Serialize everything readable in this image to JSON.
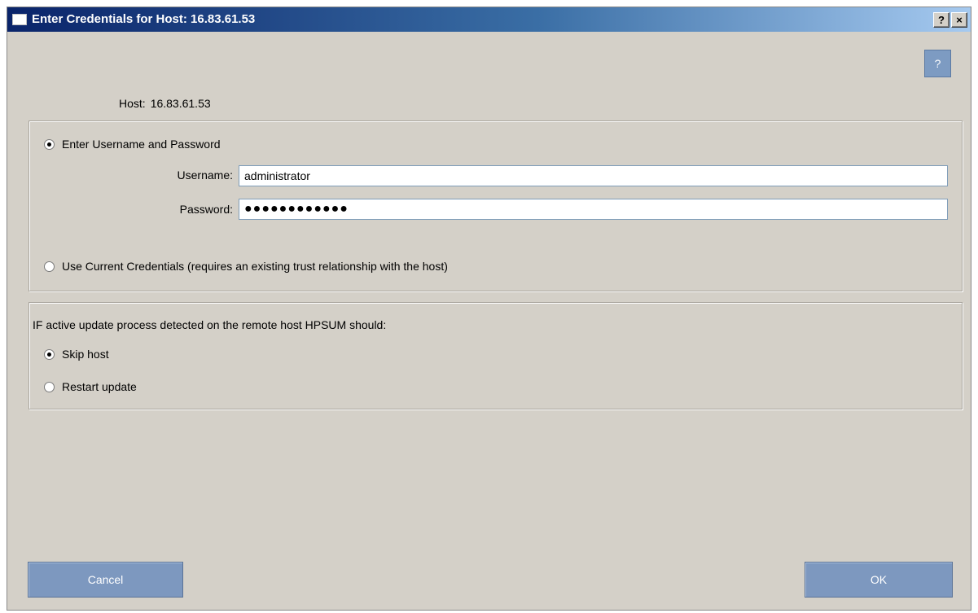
{
  "window": {
    "title": "Enter Credentials for Host: 16.83.61.53",
    "help_glyph": "?",
    "close_glyph": "×"
  },
  "help_button": {
    "label": "?",
    "icon": "help-icon"
  },
  "host": {
    "label": "Host:",
    "value": "16.83.61.53"
  },
  "credentials": {
    "option_manual_label": "Enter Username and Password",
    "option_manual_selected": true,
    "username_label": "Username:",
    "username_value": "administrator",
    "password_label": "Password:",
    "password_value": "●●●●●●●●●●●●",
    "option_current_label": "Use Current Credentials (requires an existing trust relationship with the host)",
    "option_current_selected": false
  },
  "update_policy": {
    "prompt": "IF active update process detected on the remote host HPSUM should:",
    "option_skip_label": "Skip host",
    "option_skip_selected": true,
    "option_restart_label": "Restart update",
    "option_restart_selected": false
  },
  "buttons": {
    "cancel_label": "Cancel",
    "ok_label": "OK"
  },
  "colors": {
    "dialog_bg": "#d4d0c8",
    "titlebar_start": "#0a246a",
    "titlebar_end": "#a6caf0",
    "button_bg": "#7d98bf"
  }
}
